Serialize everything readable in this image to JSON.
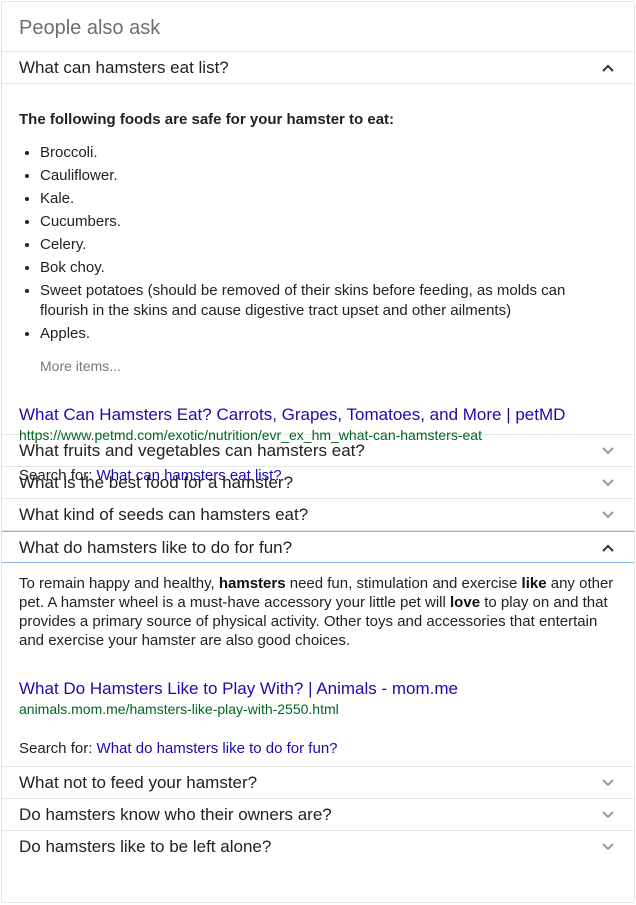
{
  "header": {
    "title": "People also ask"
  },
  "questions": [
    {
      "text": "What can hamsters eat list?",
      "expanded": true
    },
    {
      "text": "What fruits and vegetables can hamsters eat?",
      "expanded": false
    },
    {
      "text": "What is the best food for a hamster?",
      "expanded": false
    },
    {
      "text": "What kind of seeds can hamsters eat?",
      "expanded": false
    },
    {
      "text": "What do hamsters like to do for fun?",
      "expanded": true
    },
    {
      "text": "What not to feed your hamster?",
      "expanded": false
    },
    {
      "text": "Do hamsters know who their owners are?",
      "expanded": false
    },
    {
      "text": "Do hamsters like to be left alone?",
      "expanded": false
    }
  ],
  "answer1": {
    "heading": "The following foods are safe for your hamster to eat:",
    "items": [
      "Broccoli.",
      "Cauliflower.",
      "Kale.",
      "Cucumbers.",
      "Celery.",
      "Bok choy.",
      "Sweet potatoes (should be removed of their skins before feeding, as molds can flourish in the skins and cause digestive tract upset and other ailments)",
      "Apples."
    ],
    "more_items": "More items...",
    "result_title": "What Can Hamsters Eat? Carrots, Grapes, Tomatoes, and More | petMD",
    "result_url": "https://www.petmd.com/exotic/nutrition/evr_ex_hm_what-can-hamsters-eat",
    "search_for_label": "Search for: ",
    "search_for_query": "What can hamsters eat list?"
  },
  "answer2": {
    "body_parts": [
      "To remain happy and healthy, ",
      "hamsters",
      " need fun, stimulation and exercise ",
      "like",
      " any other pet. A hamster wheel is a must-have accessory your little pet will ",
      "love",
      " to play on and that provides a primary source of physical activity. Other toys and accessories that entertain and exercise your hamster are also good choices."
    ],
    "result_title": "What Do Hamsters Like to Play With? | Animals - mom.me",
    "result_url": "animals.mom.me/hamsters-like-play-with-2550.html",
    "search_for_label": "Search for: ",
    "search_for_query": "What do hamsters like to do for fun?"
  },
  "icons": {
    "collapse": "chevron-up-icon",
    "expand": "chevron-down-icon"
  },
  "colors": {
    "link": "#1a0dab",
    "url": "#006621",
    "divider": "#e6e6e6",
    "focus": "#8ab4f8"
  }
}
